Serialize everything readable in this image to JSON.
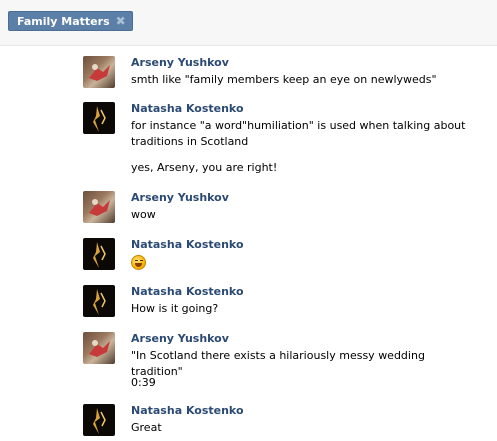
{
  "header": {
    "tag_label": "Family Matters",
    "close_glyph": "✖"
  },
  "messages": [
    {
      "author": "Arseny Yushkov",
      "texts": [
        "smth like \"family members keep an eye on newlyweds\""
      ]
    },
    {
      "author": "Natasha Kostenko",
      "texts": [
        "for instance \"a word\"humiliation\" is used when talking about traditions in Scotland",
        "yes, Arseny, you are right!"
      ]
    },
    {
      "author": "Arseny Yushkov",
      "texts": [
        "wow"
      ]
    },
    {
      "author": "Natasha Kostenko",
      "emoji": "laughing-face-emoji"
    },
    {
      "author": "Natasha Kostenko",
      "texts": [
        "How is it going?"
      ]
    },
    {
      "author": "Arseny Yushkov",
      "texts": [
        "\"In Scotland there exists a hilariously messy wedding tradition\"",
        "0:39"
      ]
    },
    {
      "author": "Natasha Kostenko",
      "texts": [
        "Great"
      ]
    }
  ],
  "colors": {
    "author": "#2b4a74",
    "tag_bg": "#5b7fa6"
  }
}
